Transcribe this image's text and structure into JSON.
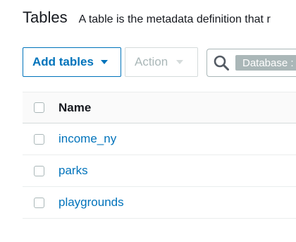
{
  "header": {
    "title": "Tables",
    "description": "A table is the metadata definition that r"
  },
  "toolbar": {
    "add_label": "Add tables",
    "action_label": "Action",
    "search_chip": "Database :"
  },
  "table": {
    "columns": [
      "Name"
    ],
    "rows": [
      {
        "name": "income_ny"
      },
      {
        "name": "parks"
      },
      {
        "name": "playgrounds"
      }
    ]
  },
  "colors": {
    "accent": "#0073bb",
    "disabled": "#aab7b8",
    "border": "#d5dbdb"
  },
  "icons": {
    "search": "search-icon",
    "add_caret": "caret-down-icon",
    "action_caret": "caret-down-icon",
    "checkbox": "checkbox-icon"
  }
}
